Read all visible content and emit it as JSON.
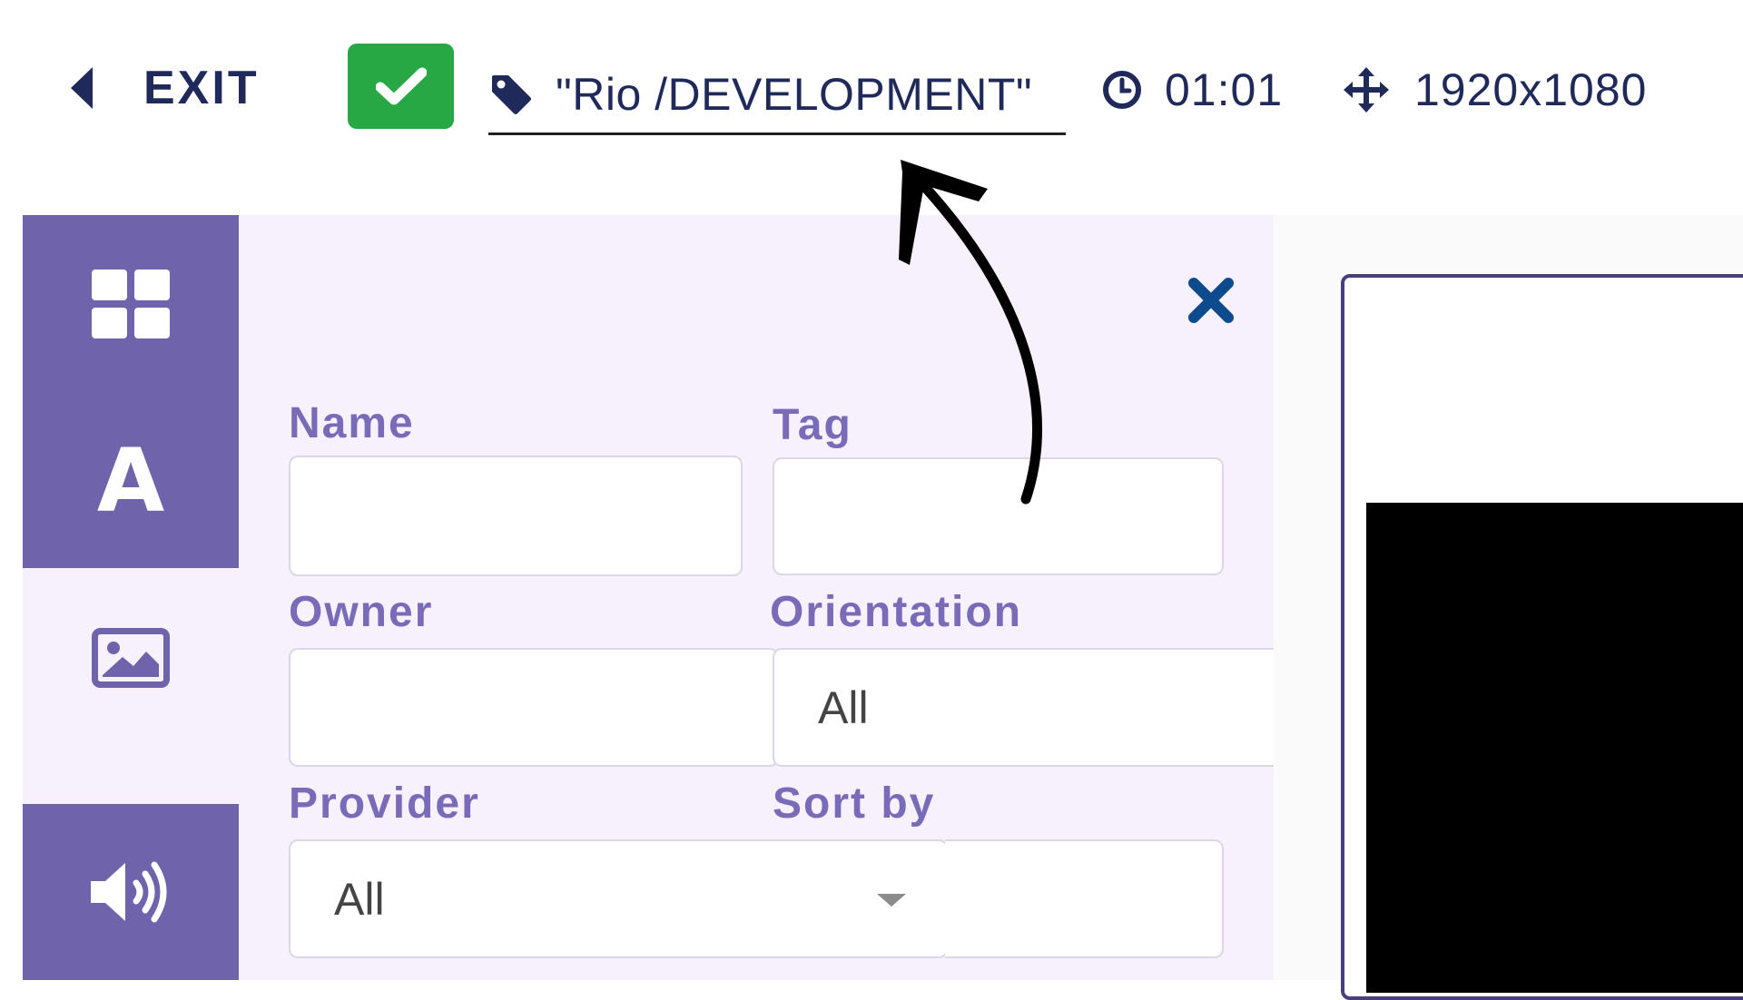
{
  "toolbar": {
    "exit_label": "EXIT",
    "confirm_icon": "check-icon",
    "playlist_tag": "\"Rio /DEVELOPMENT\"",
    "duration": "01:01",
    "resolution": "1920x1080"
  },
  "sidebar": {
    "items": [
      {
        "icon": "grid-icon",
        "active": false
      },
      {
        "icon": "text-icon",
        "glyph": "A",
        "active": false
      },
      {
        "icon": "image-icon",
        "active": true
      },
      {
        "icon": "volume-icon",
        "active": false
      }
    ]
  },
  "filters": {
    "name": {
      "label": "Name",
      "value": ""
    },
    "tag": {
      "label": "Tag",
      "value": ""
    },
    "owner": {
      "label": "Owner",
      "value": ""
    },
    "orientation": {
      "label": "Orientation",
      "value": "All"
    },
    "provider": {
      "label": "Provider",
      "value": "All"
    },
    "sort_by": {
      "label": "Sort by",
      "value": ""
    }
  },
  "colors": {
    "brand_purple": "#6f63ac",
    "label_purple": "#7a6bb8",
    "panel_bg": "#f7f1fd",
    "confirm_green": "#27a844",
    "close_blue": "#0e4a8e",
    "text_navy": "#1f2a5a"
  }
}
